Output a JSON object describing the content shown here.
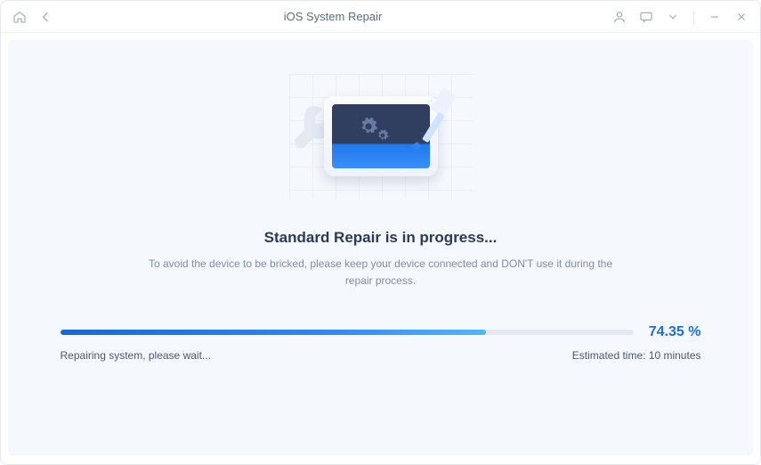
{
  "titlebar": {
    "title": "iOS System Repair"
  },
  "main": {
    "heading": "Standard Repair is in progress...",
    "subtext": "To avoid the device to be bricked, please keep your device connected and DON'T use it during the repair process."
  },
  "progress": {
    "percent_value": 74.35,
    "percent_label": "74.35 %",
    "status": "Repairing system, please wait...",
    "estimated_label": "Estimated time: 10 minutes"
  },
  "colors": {
    "accent": "#1f6fd9",
    "heading": "#2a3b55",
    "muted": "#808da4",
    "panel_bg": "#f5f8fc"
  }
}
